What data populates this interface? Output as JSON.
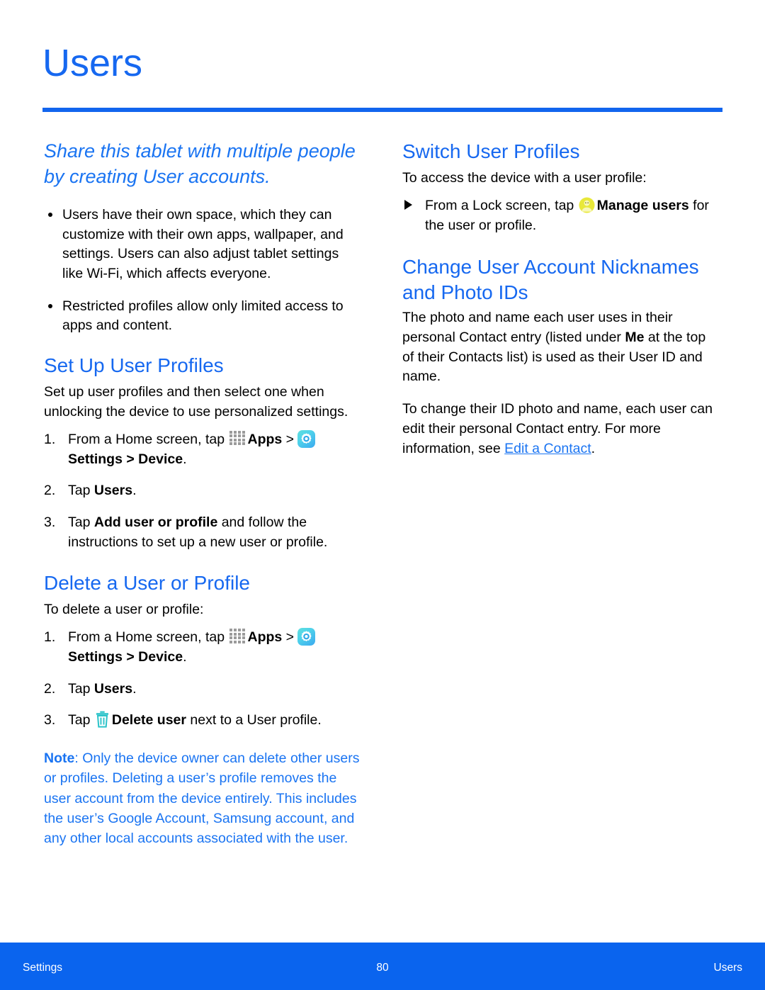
{
  "page": {
    "title": "Users",
    "accent_blue": "#1668f0",
    "rule_blue": "#1265ee",
    "footer_blue": "#0a64ee",
    "note_blue": "#1a74f2"
  },
  "left_column": {
    "lede": "Share this tablet with multiple people by creating User accounts.",
    "bullets": [
      "Users have their own space, which they can customize with their own apps, wallpaper, and settings. Users can also adjust tablet settings like Wi-Fi, which affects everyone.",
      "Restricted profiles allow only limited access to apps and content."
    ],
    "set_up": {
      "heading": "Set Up User Profiles",
      "intro": "Set up user profiles and then select one when unlocking the device to use personalized settings.",
      "steps": [
        {
          "num": "1.",
          "parts": [
            {
              "type": "text",
              "text": "From a Home screen, tap "
            },
            {
              "type": "icon",
              "icon": "apps-grid-icon"
            },
            {
              "type": "bold",
              "text": "Apps"
            },
            {
              "type": "text",
              "text": " > "
            },
            {
              "type": "icon",
              "icon": "settings-gear-icon"
            },
            {
              "type": "bold",
              "text": "Settings"
            },
            {
              "type": "bold",
              "text": " > "
            },
            {
              "type": "bold",
              "text": "Device"
            },
            {
              "type": "text",
              "text": "."
            }
          ]
        },
        {
          "num": "2.",
          "parts": [
            {
              "type": "text",
              "text": "Tap "
            },
            {
              "type": "bold",
              "text": "Users"
            },
            {
              "type": "text",
              "text": "."
            }
          ]
        },
        {
          "num": "3.",
          "parts": [
            {
              "type": "text",
              "text": "Tap "
            },
            {
              "type": "bold",
              "text": "Add user or profile"
            },
            {
              "type": "text",
              "text": " and follow the instructions to set up a new user or profile."
            }
          ]
        }
      ]
    },
    "delete": {
      "heading": "Delete a User or Profile",
      "intro": "To delete a user or profile:",
      "steps": [
        {
          "num": "1.",
          "parts": [
            {
              "type": "text",
              "text": "From a Home screen, tap "
            },
            {
              "type": "icon",
              "icon": "apps-grid-icon"
            },
            {
              "type": "bold",
              "text": "Apps"
            },
            {
              "type": "text",
              "text": " > "
            },
            {
              "type": "icon",
              "icon": "settings-gear-icon"
            },
            {
              "type": "bold",
              "text": "Settings"
            },
            {
              "type": "bold",
              "text": " > "
            },
            {
              "type": "bold",
              "text": "Device"
            },
            {
              "type": "text",
              "text": "."
            }
          ]
        },
        {
          "num": "2.",
          "parts": [
            {
              "type": "text",
              "text": "Tap "
            },
            {
              "type": "bold",
              "text": "Users"
            },
            {
              "type": "text",
              "text": "."
            }
          ]
        },
        {
          "num": "3.",
          "parts": [
            {
              "type": "text",
              "text": "Tap "
            },
            {
              "type": "icon",
              "icon": "trash-icon"
            },
            {
              "type": "bold",
              "text": "Delete user"
            },
            {
              "type": "text",
              "text": " next to a User profile."
            }
          ]
        }
      ]
    },
    "note": {
      "label": "Note",
      "separator": ": ",
      "text": "Only the device owner can delete other users or profiles. Deleting a user’s profile removes the user account from the device entirely. This includes the user’s Google Account, Samsung account, and any other local accounts associated with the user."
    }
  },
  "right_column": {
    "switch": {
      "heading": "Switch User Profiles",
      "intro": "To access the device with a user profile:",
      "bullet": {
        "parts": [
          {
            "type": "text",
            "text": "From a Lock screen, tap "
          },
          {
            "type": "icon",
            "icon": "manage-users-icon"
          },
          {
            "type": "bold",
            "text": "Manage users"
          },
          {
            "type": "text",
            "text": " for the user or profile."
          }
        ]
      }
    },
    "nicknames": {
      "heading": "Change User Account Nicknames and Photo IDs",
      "paragraph1_parts": [
        {
          "type": "text",
          "text": "The photo and name each user uses in their personal Contact entry (listed under "
        },
        {
          "type": "bold",
          "text": "Me"
        },
        {
          "type": "text",
          "text": " at the top of their Contacts list) is used as their User ID and name."
        }
      ],
      "paragraph2_parts": [
        {
          "type": "text",
          "text": "To change their ID photo and name, each user can edit their personal Contact entry. For more information, see "
        },
        {
          "type": "link",
          "text": "Edit a Contact"
        },
        {
          "type": "text",
          "text": "."
        }
      ]
    }
  },
  "footer": {
    "left": "Settings",
    "page_number": "80",
    "right": "Users"
  }
}
